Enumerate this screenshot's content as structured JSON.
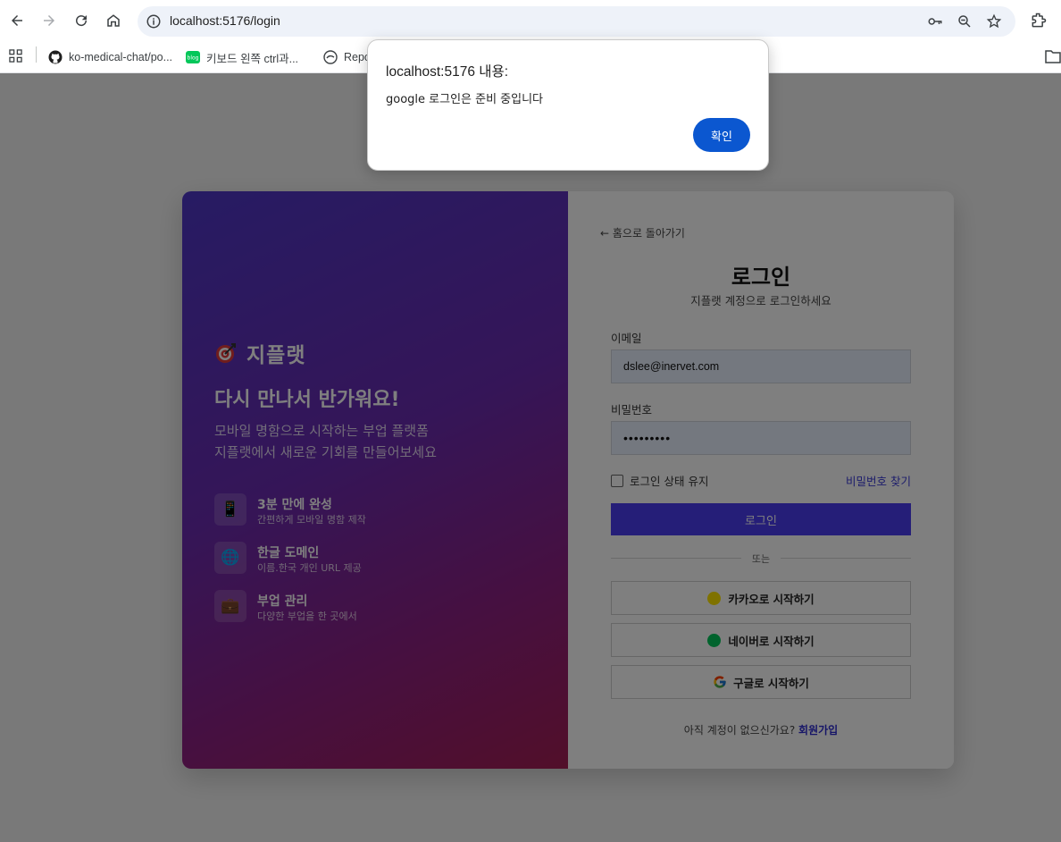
{
  "browser": {
    "url": "localhost:5176/login",
    "bookmarks": [
      {
        "label": "ko-medical-chat/po..."
      },
      {
        "label": "키보드 왼쪽 ctrl과..."
      },
      {
        "label": "Repo"
      }
    ]
  },
  "dialog": {
    "title": "localhost:5176 내용:",
    "message": "google 로그인은 준비 중입니다",
    "ok_label": "확인"
  },
  "left_panel": {
    "brand_name": "지플랫",
    "welcome": "다시 만나서 반가워요!",
    "subtitle_line1": "모바일 명함으로 시작하는 부업 플랫폼",
    "subtitle_line2": "지플랫에서 새로운 기회를 만들어보세요",
    "features": [
      {
        "icon": "📱",
        "title": "3분 만에 완성",
        "desc": "간편하게 모바일 명함 제작"
      },
      {
        "icon": "🌐",
        "title": "한글 도메인",
        "desc": "이름.한국 개인 URL 제공"
      },
      {
        "icon": "💼",
        "title": "부업 관리",
        "desc": "다양한 부업을 한 곳에서"
      }
    ]
  },
  "login_form": {
    "back_link": "← 홈으로 돌아가기",
    "title": "로그인",
    "subtitle": "지플랫 계정으로 로그인하세요",
    "email_label": "이메일",
    "email_value": "dslee@inervet.com",
    "password_label": "비밀번호",
    "password_value": "•••••••••",
    "remember_label": "로그인 상태 유지",
    "forgot_label": "비밀번호 찾기",
    "login_button": "로그인",
    "or_text": "또는",
    "kakao_label": "카카오로 시작하기",
    "naver_label": "네이버로 시작하기",
    "google_label": "구글로 시작하기",
    "signup_prompt": "아직 계정이 없으신가요?",
    "signup_link": "회원가입"
  },
  "colors": {
    "kakao": "#FEE500",
    "naver": "#03C75A",
    "primary": "#4A3DF0",
    "dialog_button": "#0B57D0"
  }
}
